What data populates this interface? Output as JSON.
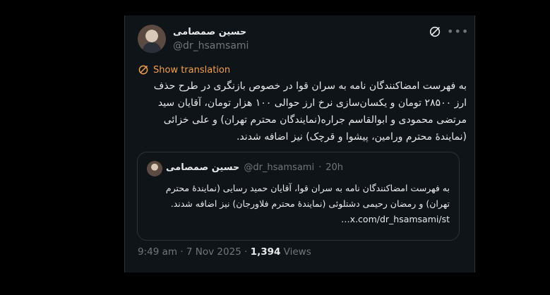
{
  "author": {
    "name": "حسین صمصامی",
    "handle": "@dr_hsamsami"
  },
  "icons": {
    "grok": "grok-icon",
    "more": "more-icon",
    "translate": "translate-icon"
  },
  "translate": {
    "label": "Show translation"
  },
  "tweet": {
    "text": "به فهرست امضاکنندگان نامه به سران قوا در خصوص بازنگری در طرح حذف ارز ۲۸۵۰۰ تومان و یکسان‌سازی نرخ ارز حوالی ۱۰۰ هزار تومان، آقایان سید مرتضی محمودی و ابوالقاسم جراره(نمایندگان محترم تهران) و علی خزائی (نمایندهٔ محترم ورامین، پیشوا و قرچک) نیز اضافه شدند."
  },
  "quote": {
    "name": "حسین صمصامی",
    "handle": "@dr_hsamsami",
    "separator": "·",
    "time": "20h",
    "text": "به فهرست امضاکنندگان نامه به سران قوا، آقایان حمید رسایی (نمایندهٔ محترم تهران) و رمضان رحیمی دشتلوئی (نمایندهٔ محترم فلاورجان) نیز اضافه شدند. x.com/dr_hsamsami/st…"
  },
  "meta": {
    "time": "9:49 am",
    "separator": " · ",
    "date": "7 Nov 2025",
    "separator2": " · ",
    "views_count": "1,394",
    "views_label": " Views"
  },
  "colors": {
    "background": "#000000",
    "card": "#0f1419",
    "text": "#e7e9ea",
    "muted": "#71767b",
    "accent_orange": "#f5a14b",
    "border": "#2f3336"
  }
}
